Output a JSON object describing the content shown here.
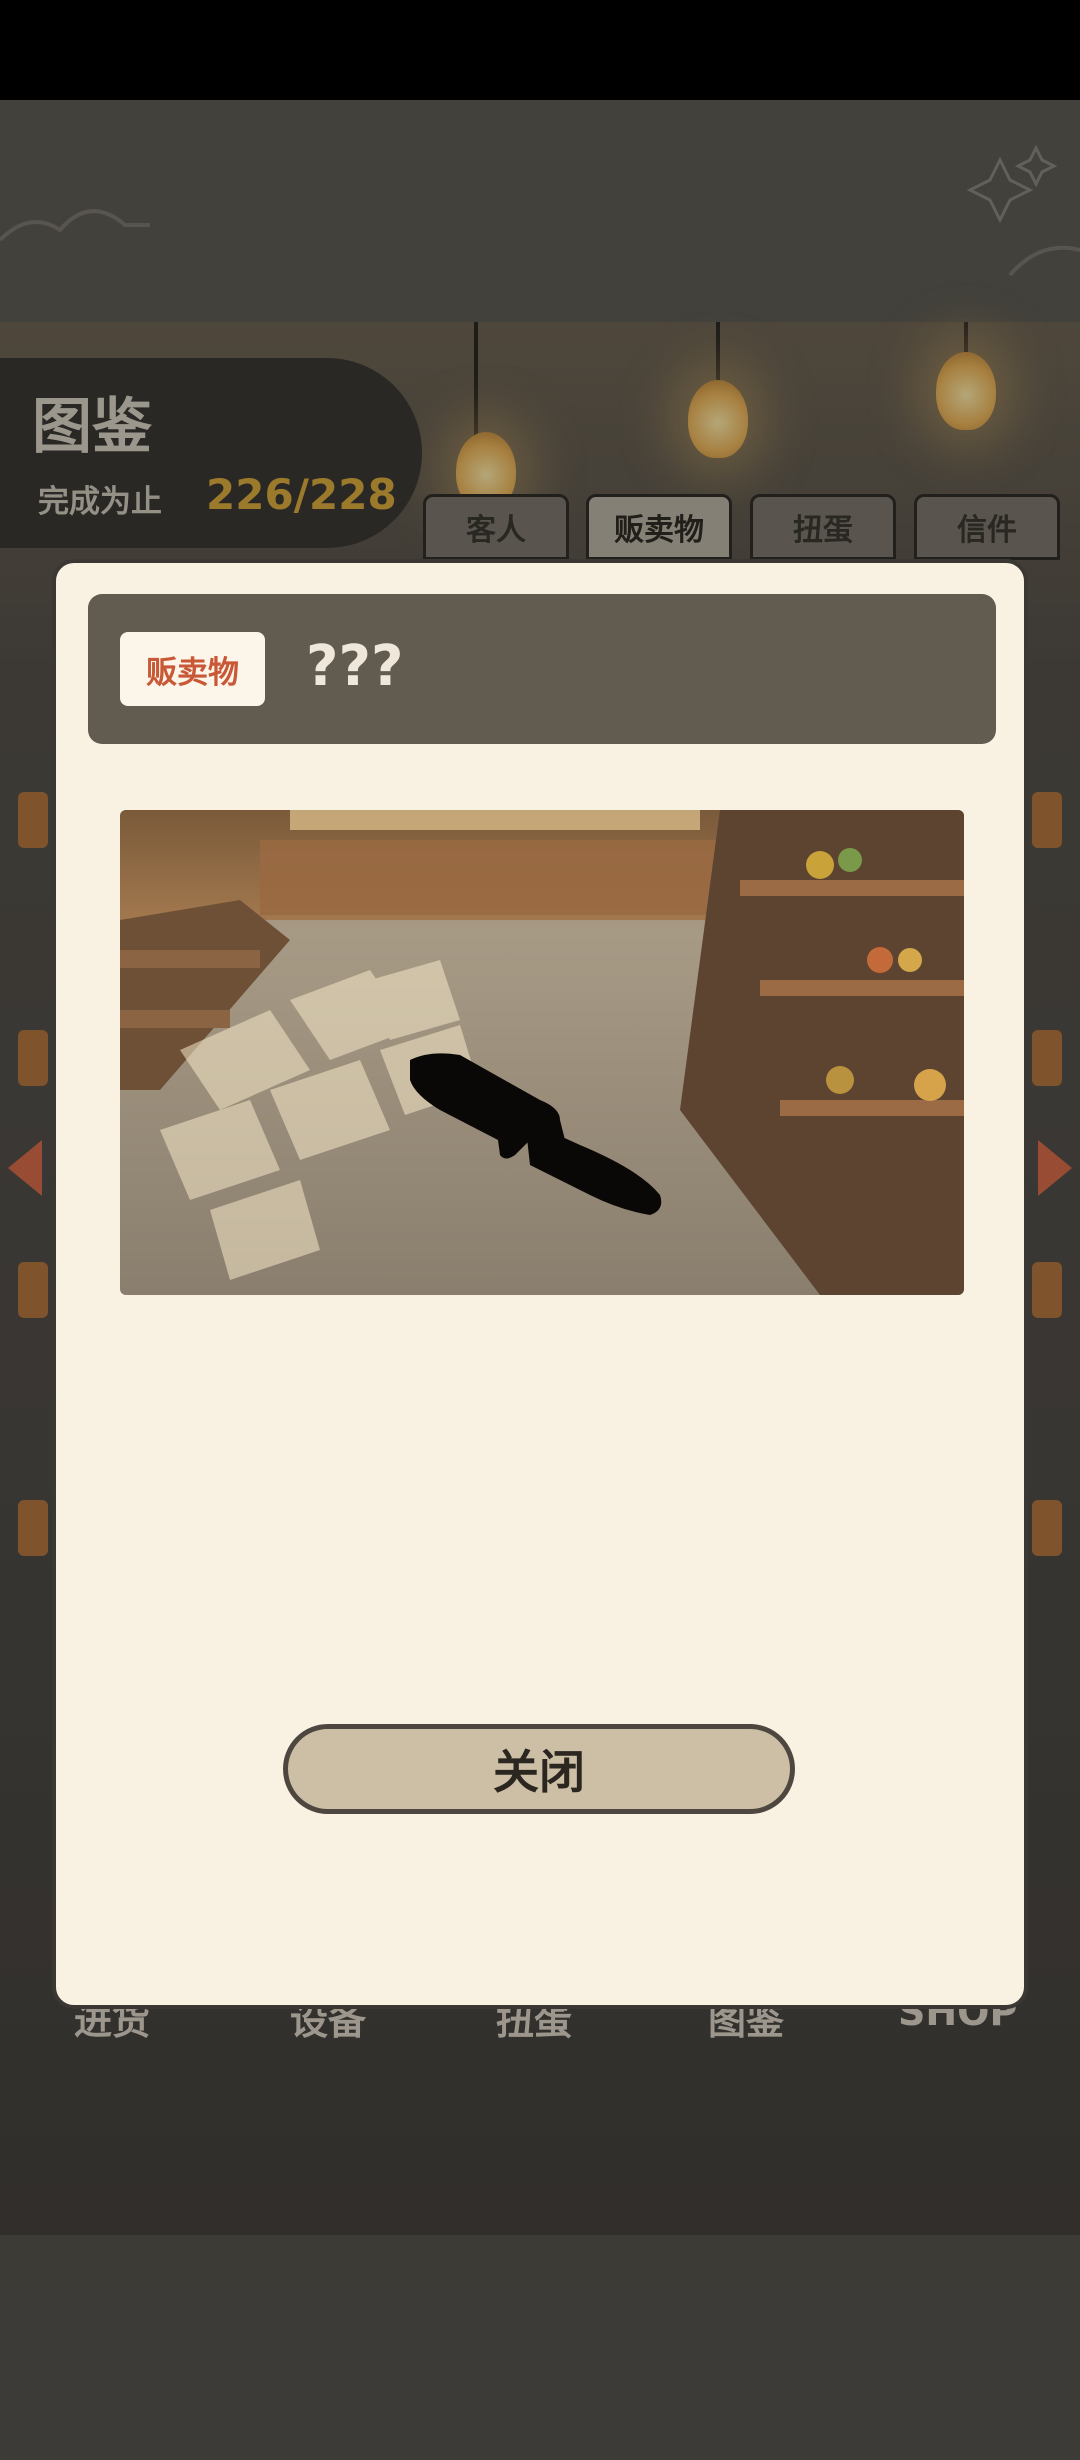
{
  "codex": {
    "title": "图鉴",
    "progress_label": "完成为止",
    "progress_value": "226/228"
  },
  "tabs": [
    {
      "label": "客人",
      "active": false
    },
    {
      "label": "贩卖物",
      "active": true
    },
    {
      "label": "扭蛋",
      "active": false
    },
    {
      "label": "信件",
      "active": false
    }
  ],
  "bottom_nav": [
    "进货",
    "设备",
    "扭蛋",
    "图鉴",
    "SHOP"
  ],
  "modal": {
    "category": "贩卖物",
    "item_name": "???",
    "close_label": "关闭"
  },
  "colors": {
    "accent": "#d9a93e",
    "badge_text": "#c85836",
    "modal_bg": "#f9f2e3"
  }
}
